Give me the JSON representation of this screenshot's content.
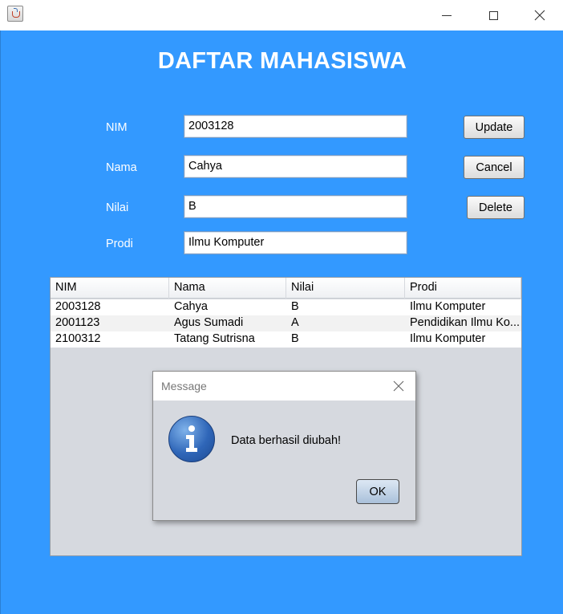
{
  "window": {
    "title": ""
  },
  "form": {
    "heading": "DAFTAR MAHASISWA",
    "fields": [
      {
        "label": "NIM",
        "value": "2003128"
      },
      {
        "label": "Nama",
        "value": "Cahya"
      },
      {
        "label": "Nilai",
        "value": "B"
      },
      {
        "label": "Prodi",
        "value": "Ilmu Komputer"
      }
    ],
    "buttons": {
      "update": "Update",
      "cancel": "Cancel",
      "delete": "Delete"
    }
  },
  "table": {
    "columns": [
      "NIM",
      "Nama",
      "Nilai",
      "Prodi"
    ],
    "rows": [
      [
        "2003128",
        "Cahya",
        "B",
        "Ilmu Komputer"
      ],
      [
        "2001123",
        "Agus Sumadi",
        "A",
        "Pendidikan Ilmu Ko..."
      ],
      [
        "2100312",
        "Tatang Sutrisna",
        "B",
        "Ilmu Komputer"
      ]
    ]
  },
  "dialog": {
    "title": "Message",
    "message": "Data berhasil diubah!",
    "ok_label": "OK",
    "icon": "info-icon"
  },
  "colors": {
    "background": "#3399ff",
    "heading": "#ffffff"
  }
}
